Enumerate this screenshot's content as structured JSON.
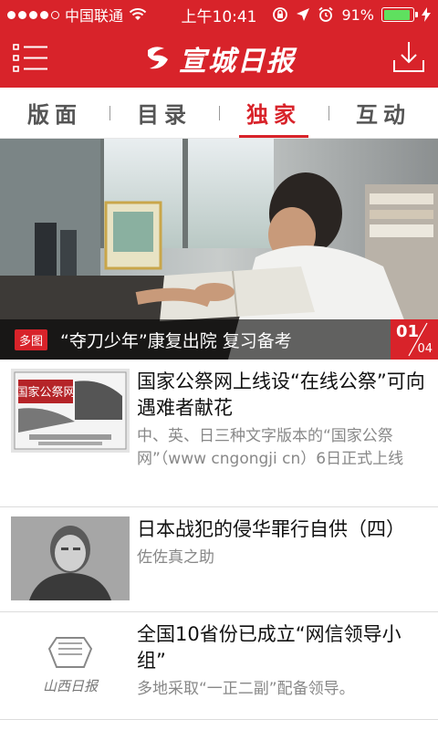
{
  "status_bar": {
    "carrier": "中国联通",
    "time": "上午10:41",
    "battery": "91%",
    "battery_level": 0.91
  },
  "header": {
    "logo_text": "宣城日报",
    "menu_icon": "menu-icon",
    "download_icon": "download-icon"
  },
  "tabs": [
    {
      "label": "版面",
      "active": false
    },
    {
      "label": "目录",
      "active": false
    },
    {
      "label": "独家",
      "active": true
    },
    {
      "label": "互动",
      "active": false
    }
  ],
  "hero": {
    "tag": "多图",
    "title": "“夺刀少年”康复出院 复习备考",
    "page_current": "01",
    "page_total": "04"
  },
  "news": [
    {
      "title": "国家公祭网上线设“在线公祭”可向遇难者献花",
      "summary": "中、英、日三种文字版本的“国家公祭网”（www cngongji cn）6日正式上线",
      "thumb_text": "国家公祭网"
    },
    {
      "title": "日本战犯的侵华罪行自供（四）",
      "summary": "佐佐真之助"
    },
    {
      "title": "全国10省份已成立“网信领导小组”",
      "summary": "多地采取“一正二副”配备领导。",
      "thumb_text": "山西日报"
    }
  ],
  "colors": {
    "brand_red": "#d8232a",
    "tab_inactive": "#555555",
    "summary_gray": "#888888"
  }
}
